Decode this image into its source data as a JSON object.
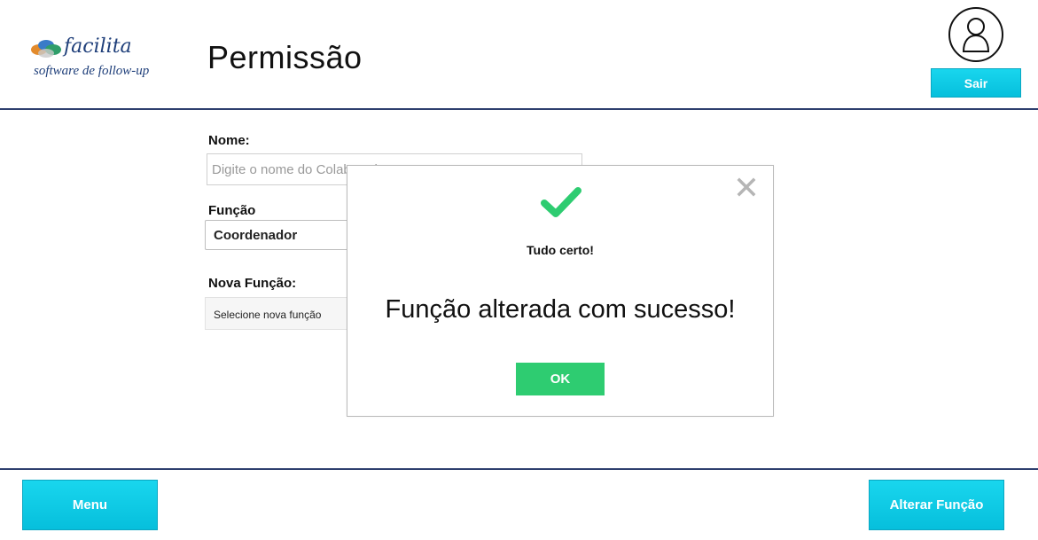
{
  "header": {
    "logo": {
      "name": "facilita",
      "tagline": "software de follow-up"
    },
    "title": "Permissão",
    "logout_label": "Sair"
  },
  "form": {
    "nome": {
      "label": "Nome:",
      "placeholder": "Digite o nome do Colaborador",
      "value": ""
    },
    "funcao": {
      "label": "Função",
      "value": "Coordenador"
    },
    "nova_funcao": {
      "label": "Nova Função:",
      "value": "Selecione nova função"
    }
  },
  "modal": {
    "title": "Tudo certo!",
    "message": "Função alterada com sucesso!",
    "ok_label": "OK"
  },
  "footer": {
    "menu_label": "Menu",
    "submit_label": "Alterar Função"
  },
  "colors": {
    "accent_cyan": "#0fcbe6",
    "success_green": "#2ecc71",
    "divider_navy": "#2e3f6e",
    "brand_blue": "#1f3f7a"
  },
  "icons": [
    "logo-mark-icon",
    "user-icon",
    "close-icon",
    "checkmark-icon"
  ]
}
